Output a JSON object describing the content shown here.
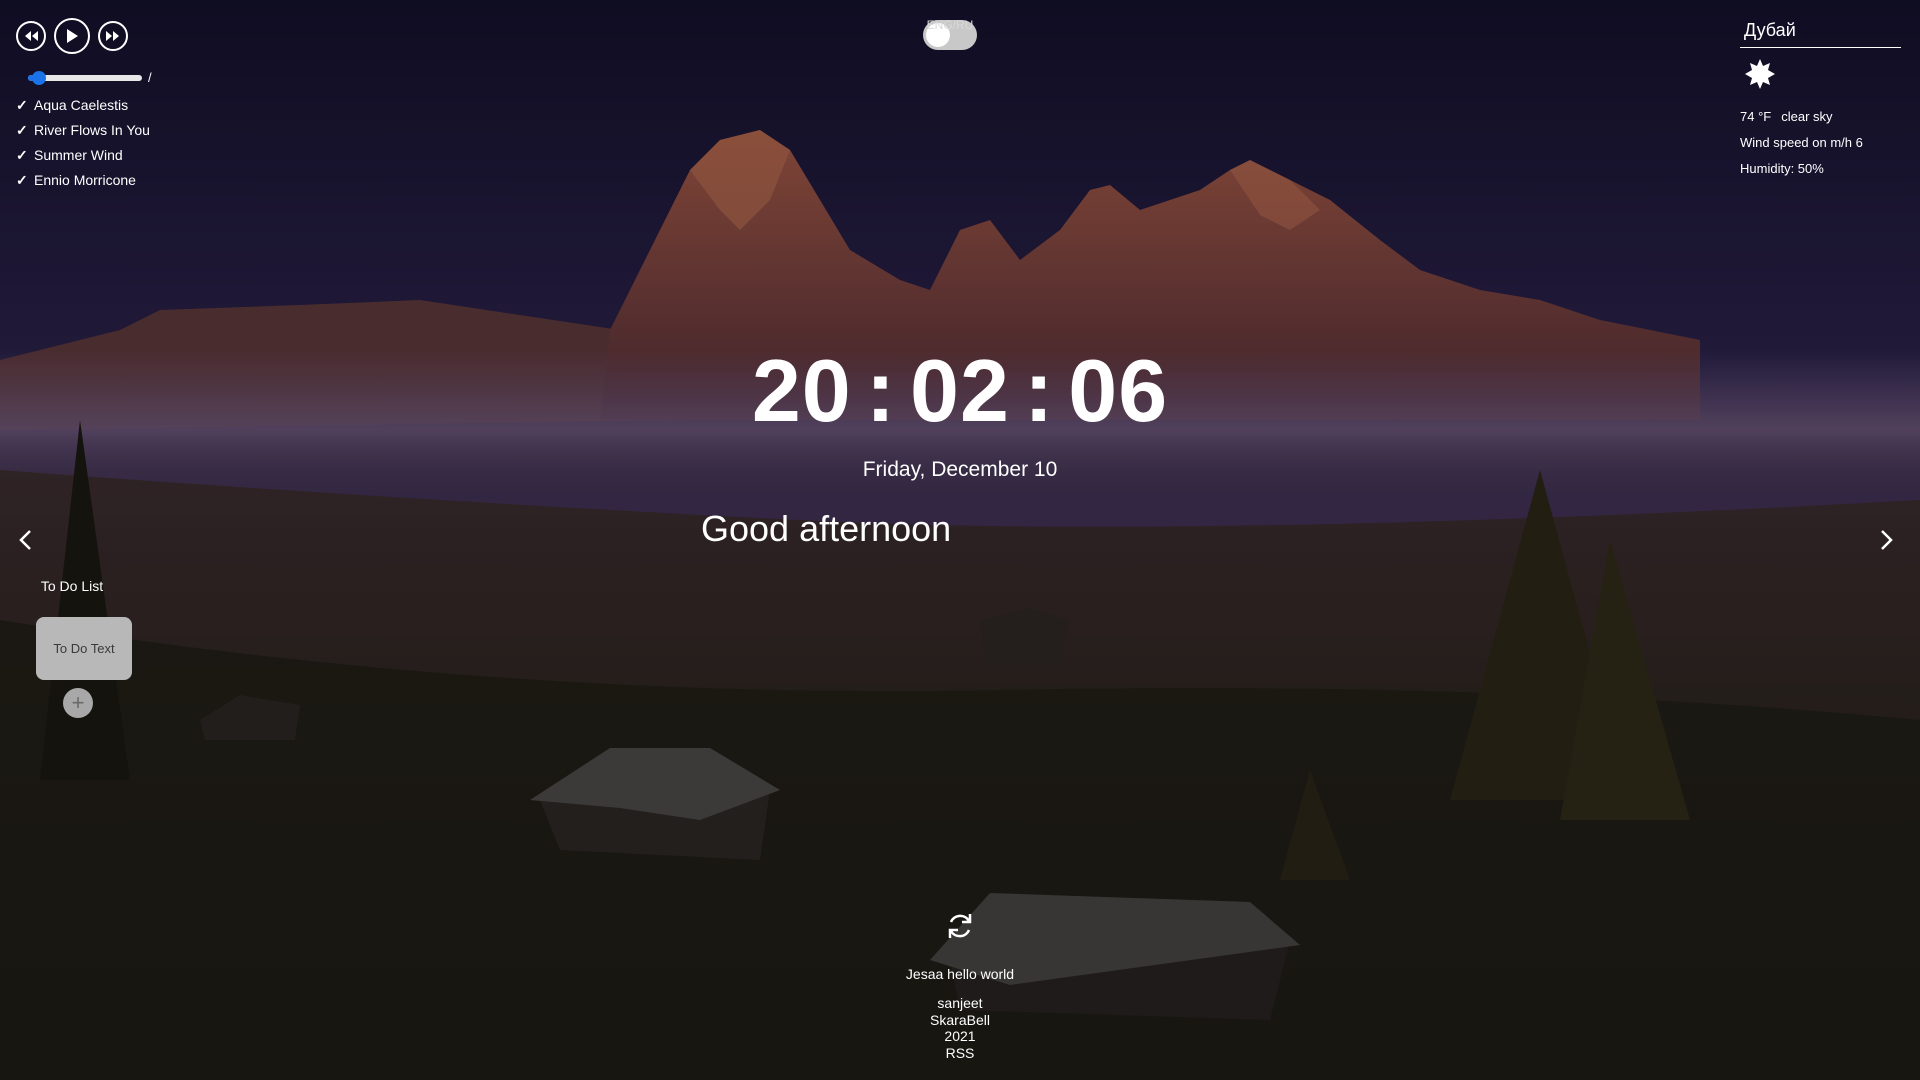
{
  "player": {
    "icons": {
      "prev": "rewind-icon",
      "play": "play-icon",
      "next": "fast-forward-icon"
    },
    "progress": 0.1,
    "time_separator": "/",
    "playlist": [
      "Aqua Caelestis",
      "River Flows In You",
      "Summer Wind",
      "Ennio Morricone"
    ],
    "check_glyph": "✓"
  },
  "language": {
    "label": "ENG/RU"
  },
  "weather": {
    "city": "Дубай",
    "icon": "sun-icon",
    "temperature": "74 °F",
    "description": "clear sky",
    "wind": "Wind speed on m/h 6",
    "humidity": "Humidity: 50%"
  },
  "clock": {
    "hours": "20",
    "minutes": "02",
    "seconds": "06",
    "separator": ":"
  },
  "date": "Friday, December 10",
  "greeting": "Good afternoon",
  "todo": {
    "title": "To Do List",
    "placeholder": "To Do Text",
    "add_glyph": "+"
  },
  "quote": {
    "text": "Jesaa hello world",
    "refresh_icon": "refresh-icon"
  },
  "credits": [
    "sanjeet",
    "SkaraBell",
    "2021",
    "RSS"
  ],
  "colors": {
    "accent": "#1a73e8",
    "text": "#ffffff",
    "todo_card": "#b8b8b8"
  }
}
